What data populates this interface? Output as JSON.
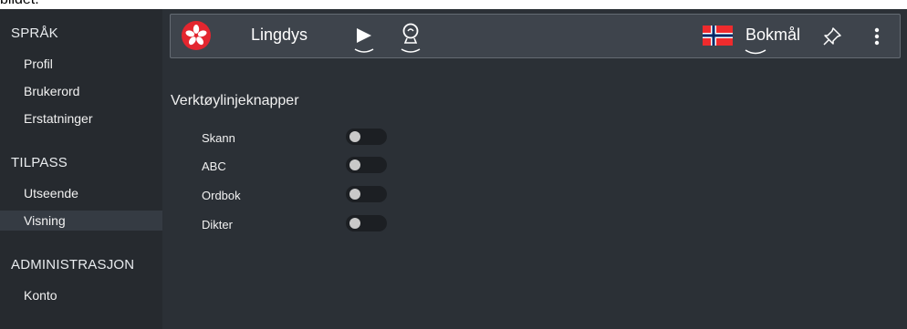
{
  "cropped_text": "bildet.",
  "sidebar": {
    "sections": [
      {
        "title": "SPRÅK",
        "items": [
          {
            "label": "Profil"
          },
          {
            "label": "Brukerord"
          },
          {
            "label": "Erstatninger"
          }
        ]
      },
      {
        "title": "TILPASS",
        "items": [
          {
            "label": "Utseende"
          },
          {
            "label": "Visning",
            "active": true
          }
        ]
      },
      {
        "title": "ADMINISTRASJON",
        "items": [
          {
            "label": "Konto"
          }
        ]
      }
    ]
  },
  "toolbar": {
    "app_name": "Lingdys",
    "logo_icon": "lingdys-flower-logo-icon",
    "play_icon": "play-icon",
    "voice_icon": "voice-bubble-icon",
    "language": "Bokmål",
    "language_flag": "norway-flag-icon",
    "pin_icon": "pin-icon",
    "menu_icon": "kebab-menu-icon"
  },
  "main": {
    "title": "Verktøylinjeknapper",
    "options": [
      {
        "label": "Skann",
        "on": false
      },
      {
        "label": "ABC",
        "on": false
      },
      {
        "label": "Ordbok",
        "on": false
      },
      {
        "label": "Dikter",
        "on": false
      }
    ]
  },
  "colors": {
    "background": "#2b3036",
    "sidebar": "#262a2f",
    "toolbar": "#3e444c",
    "logo": "#e3262f",
    "toggle_track": "#1c1f23"
  }
}
